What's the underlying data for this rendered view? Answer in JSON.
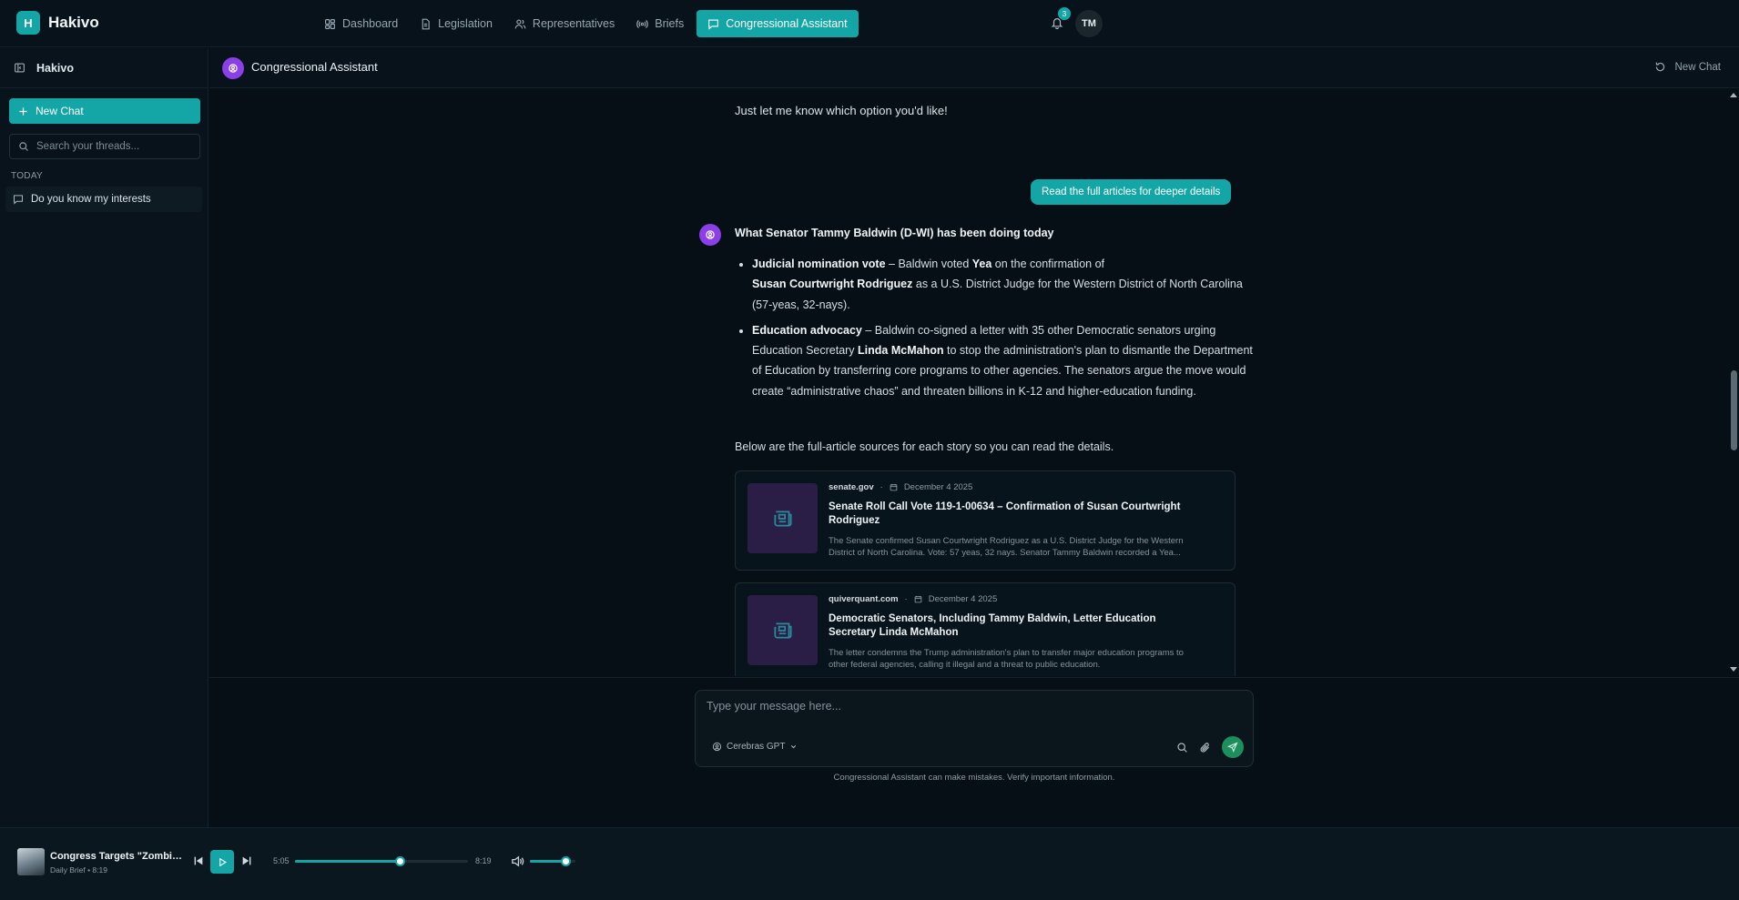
{
  "app": {
    "logo_letter": "H",
    "name": "Hakivo",
    "nav": [
      "Dashboard",
      "Legislation",
      "Representatives",
      "Briefs",
      "Congressional Assistant"
    ],
    "active_nav": "Congressional Assistant",
    "notifications_count": "3",
    "user_initials": "TM"
  },
  "sidebar": {
    "title": "Hakivo",
    "new_chat_label": "New Chat",
    "search_placeholder": "Search your threads...",
    "section_label": "TODAY",
    "threads": [
      "Do you know my interests"
    ]
  },
  "chat": {
    "title": "Congressional Assistant",
    "new_chat_label": "New Chat",
    "intro_line": "Just let me know which option you'd like!",
    "user_message": "Read the full articles for deeper details",
    "response_title": "What Senator Tammy Baldwin (D-WI) has been doing today",
    "bullet1": {
      "label": "Judicial nomination vote",
      "t1": " – Baldwin voted ",
      "b1": "Yea",
      "t2": " on the confirmation of ",
      "b2": "Susan Courtwright Rodriguez",
      "t3": " as a U.S. District Judge for the Western District of North Carolina (57-yeas, 32-nays)."
    },
    "bullet2": {
      "label": "Education advocacy",
      "t1": " – Baldwin co-signed a letter with 35 other Democratic senators urging Education Secretary ",
      "b1": "Linda McMahon",
      "t2": " to stop the administration's plan to dismantle the Department of Education by transferring core programs to other agencies. The senators argue the move would create “administrative chaos” and threaten billions in K-12 and higher-education funding."
    },
    "sources_intro": "Below are the full-article sources for each story so you can read the details.",
    "sources": [
      {
        "source": "senate.gov",
        "date": "December 4 2025",
        "title": "Senate Roll Call Vote 119-1-00634 – Confirmation of Susan Courtwright Rodriguez",
        "snippet": "The Senate confirmed Susan Courtwright Rodriguez as a U.S. District Judge for the Western District of North Carolina. Vote: 57 yeas, 32 nays. Senator Tammy Baldwin recorded a Yea..."
      },
      {
        "source": "quiverquant.com",
        "date": "December 4 2025",
        "title": "Democratic Senators, Including Tammy Baldwin, Letter Education Secretary Linda McMahon",
        "snippet": "The letter condemns the Trump administration's plan to transfer major education programs to other federal agencies, calling it illegal and a threat to public education."
      }
    ]
  },
  "composer": {
    "placeholder": "Type your message here...",
    "model": "Cerebras GPT",
    "disclaimer": "Congressional Assistant can make mistakes. Verify important information."
  },
  "player": {
    "title": "Congress Targets \"Zombie Pro...",
    "subtitle": "Daily Brief • 8:19",
    "current_time": "5:05",
    "duration": "8:19",
    "progress_fraction": 0.607,
    "volume_fraction": 0.78
  },
  "colors": {
    "accent": "#14a6a6",
    "bot_avatar": "#8b3fe6",
    "background": "#060f15"
  }
}
